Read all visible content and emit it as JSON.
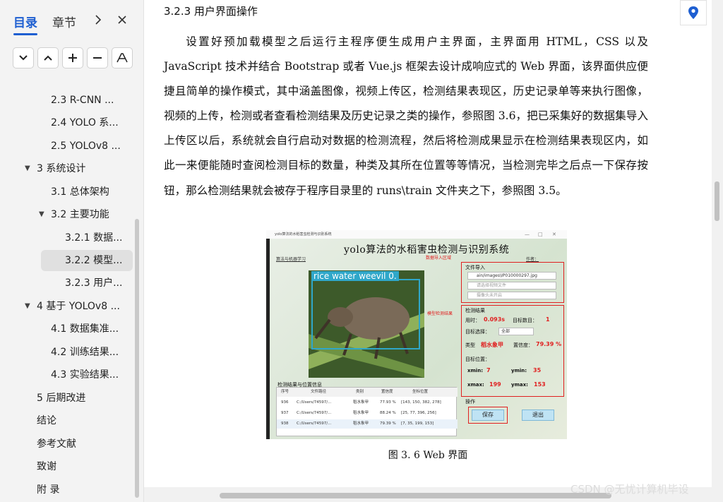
{
  "sidebar": {
    "tabs": [
      {
        "label": "目录"
      },
      {
        "label": "章节"
      }
    ],
    "toc": [
      {
        "label": "2.3 R-CNN ..."
      },
      {
        "label": "2.4 YOLO 系..."
      },
      {
        "label": "2.5 YOLOv8 ..."
      },
      {
        "label": "3 系统设计"
      },
      {
        "label": "3.1 总体架构"
      },
      {
        "label": "3.2 主要功能"
      },
      {
        "label": "3.2.1 数据..."
      },
      {
        "label": "3.2.2 模型..."
      },
      {
        "label": "3.2.3 用户..."
      },
      {
        "label": "4 基于 YOLOv8 ..."
      },
      {
        "label": "4.1 数据集准..."
      },
      {
        "label": "4.2 训练结果..."
      },
      {
        "label": "4.3 实验结果..."
      },
      {
        "label": "5 后期改进"
      },
      {
        "label": "结论"
      },
      {
        "label": "参考文献"
      },
      {
        "label": "致谢"
      },
      {
        "label": "附 录"
      }
    ]
  },
  "doc": {
    "heading": "3.2.3 用户界面操作",
    "paragraph": "设置好预加载模型之后运行主程序便生成用户主界面，主界面用 HTML，CSS 以及 JavaScript 技术并结合 Bootstrap 或者 Vue.js 框架去设计成响应式的 Web 界面，该界面供应便捷且简单的操作模式，其中涵盖图像，视频上传区，检测结果表现区，历史记录单等来执行图像，视频的上传，检测或者查看检测结果及历史记录之类的操作，参照图 3.6，把已采集好的数据集导入上传区以后，系统就会自行启动对数据的检测流程，然后将检测成果显示在检测结果表现区内，如此一来便能随时查阅检测目标的数量，种类及其所在位置等等情况，当检测完毕之后点一下保存按钮，那么检测结果就会被存于程序目录里的 runs\\train 文件夹之下，参照图 3.5。",
    "caption": "图 3. 6 Web 界面"
  },
  "figure": {
    "window_title": "yolo算法的水稻害虫检测与识别系统",
    "app_title": "yolo算法的水稻害虫检测与识别系统",
    "algo_label": "算法与机器学习",
    "author_label": "作者：",
    "upload_area_label": "数据导入区域",
    "result_area_label": "模型检测结果",
    "detect_label": "rice water weevil",
    "detect_score": "0.",
    "file_import": {
      "title": "文件导入",
      "image_path": "ain/images\\IP010000297.jpg",
      "video_placeholder": "请选择视频文件",
      "camera_placeholder": "摄像头未开启"
    },
    "results": {
      "title": "检测结果",
      "time_label": "用时：",
      "time_value": "0.093s",
      "count_label": "目标数目：",
      "count_value": "1",
      "target_select_label": "目标选择：",
      "target_select_value": "全部",
      "class_label": "类型",
      "class_value": "稻水象甲",
      "conf_label": "置信度：",
      "conf_value": "79.39 %",
      "pos_label": "目标位置：",
      "xmin_label": "xmin:",
      "xmin_value": "7",
      "ymin_label": "ymin:",
      "ymin_value": "35",
      "xmax_label": "xmax:",
      "xmax_value": "199",
      "ymax_label": "ymax:",
      "ymax_value": "153"
    },
    "table": {
      "title": "检测结果与位置信息",
      "headers": [
        "序号",
        "文件路径",
        "类别",
        "置信度",
        "坐标位置"
      ],
      "rows": [
        [
          "936",
          "C:/Users/74597/...",
          "稻水象甲",
          "77.93 %",
          "[143, 150, 382, 278]"
        ],
        [
          "937",
          "C:/Users/74597/...",
          "稻水象甲",
          "88.24 %",
          "[25, 77, 396, 256]"
        ],
        [
          "938",
          "C:/Users/74597/...",
          "稻水象甲",
          "79.39 %",
          "[7, 35, 199, 153]"
        ]
      ]
    },
    "ops": {
      "title": "操作",
      "save": "保存",
      "exit": "退出"
    }
  },
  "watermark": "CSDN @无忧计算机毕设",
  "colors": {
    "accent": "#1e5fd1",
    "highlight_red": "#e02020",
    "detect_box": "#2fa7c9"
  }
}
